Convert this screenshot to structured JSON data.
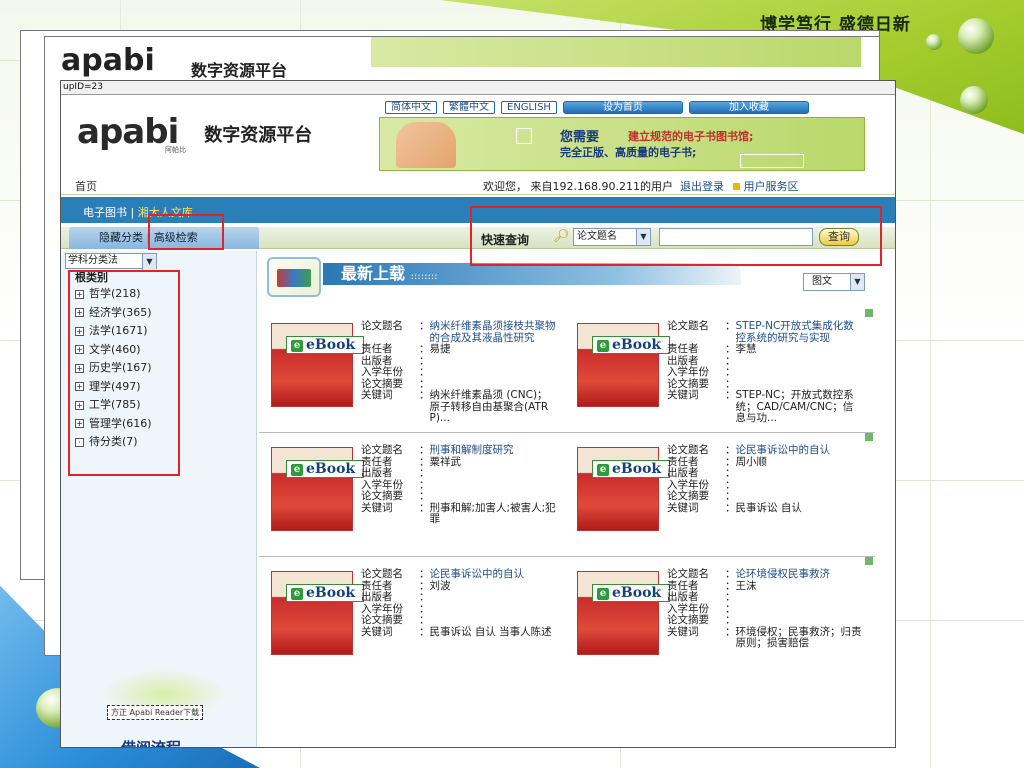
{
  "slide": {
    "motto": "博学笃行 盛德日新"
  },
  "back_window": {
    "logo_text": "apabi",
    "platform_text": "数字资源平台"
  },
  "address_bar": {
    "text": "upID=23"
  },
  "top_links": [
    {
      "label": "简体中文"
    },
    {
      "label": "繁體中文"
    },
    {
      "label": "ENGLISH"
    },
    {
      "label": "设为首页"
    },
    {
      "label": "加入收藏"
    }
  ],
  "logo": {
    "word": "apabi",
    "sub": "阿帕比",
    "platform": "数字资源平台"
  },
  "banner": {
    "line1": "您需要",
    "line1_red": "建立规范的电子书图书馆;",
    "line2": "完全正版、高质量的电子书;"
  },
  "home_bar": {
    "home": "首页",
    "welcome_prefix": "欢迎您， 来自",
    "ip": "192.168.90.211",
    "welcome_suffix": "的用户",
    "logout": "退出登录",
    "user_service": "用户服务区"
  },
  "nav": {
    "ebook": "电子图书",
    "sep": "|",
    "library": "湘大人文库"
  },
  "subnav": {
    "hide_class": "隐藏分类",
    "sep": "|",
    "advanced": "高级检索"
  },
  "quick_search": {
    "label": "快速查询",
    "field_selected": "论文题名",
    "query_value": "",
    "button": "查询"
  },
  "sidebar": {
    "class_method": "学科分类法",
    "root": "根类别",
    "categories": [
      {
        "label": "哲学(218)",
        "icon": "+"
      },
      {
        "label": "经济学(365)",
        "icon": "+"
      },
      {
        "label": "法学(1671)",
        "icon": "+"
      },
      {
        "label": "文学(460)",
        "icon": "+"
      },
      {
        "label": "历史学(167)",
        "icon": "+"
      },
      {
        "label": "理学(497)",
        "icon": "+"
      },
      {
        "label": "工学(785)",
        "icon": "+"
      },
      {
        "label": "管理学(616)",
        "icon": "+"
      },
      {
        "label": "待分类(7)",
        "icon": "·"
      }
    ],
    "reader_download": "方正 Apabi Reader下载",
    "flow": "借阅流程"
  },
  "content": {
    "latest_title": "最新上载",
    "latest_dots": "::::::::",
    "view_mode": "图文",
    "badge": "eBook",
    "labels": {
      "title": "论文题名",
      "author": "责任者",
      "publisher": "出版者",
      "year": "入学年份",
      "abstract": "论文摘要",
      "keywords": "关键词"
    },
    "books": [
      {
        "title": "纳米纤维素晶须接枝共聚物的合成及其液晶性研究",
        "author": "易捷",
        "keywords": "纳米纤维素晶须 (CNC)；原子转移自由基聚合(ATRP)..."
      },
      {
        "title": "STEP-NC开放式集成化数控系统的研究与实现",
        "author": "李慧",
        "keywords": "STEP-NC；开放式数控系统；CAD/CAM/CNC；信息与功..."
      },
      {
        "title": "刑事和解制度研究",
        "author": "粟祥武",
        "keywords": "刑事和解;加害人;被害人;犯罪"
      },
      {
        "title": "论民事诉讼中的自认",
        "author": "周小顺",
        "keywords": "民事诉讼 自认"
      },
      {
        "title": "论民事诉讼中的自认",
        "author": "刘波",
        "keywords": "民事诉讼 自认 当事人陈述"
      },
      {
        "title": "论环境侵权民事救济",
        "author": "王沫",
        "keywords": "环境侵权；民事救济；归责原则；损害赔偿"
      }
    ]
  },
  "colors": {
    "accent_blue": "#2a7fb8",
    "annotation_red": "#e0242a",
    "link_blue": "#1e4e8a"
  }
}
